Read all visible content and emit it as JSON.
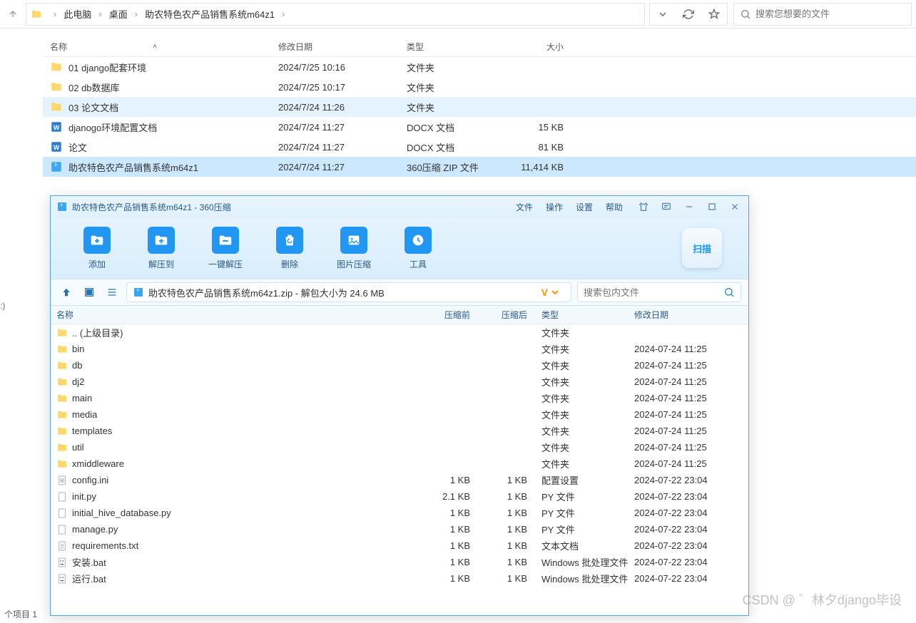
{
  "topbar": {
    "breadcrumb": [
      "此电脑",
      "桌面",
      "助农特色农产品销售系统m64z1"
    ],
    "search_placeholder": "搜索您想要的文件"
  },
  "filelist": {
    "headers": {
      "name": "名称",
      "date": "修改日期",
      "type": "类型",
      "size": "大小"
    },
    "rows": [
      {
        "icon": "folder",
        "name": "01 django配套环境",
        "date": "2024/7/25 10:16",
        "type": "文件夹",
        "size": ""
      },
      {
        "icon": "folder",
        "name": "02 db数据库",
        "date": "2024/7/25 10:17",
        "type": "文件夹",
        "size": ""
      },
      {
        "icon": "folder",
        "name": "03 论文文档",
        "date": "2024/7/24 11:26",
        "type": "文件夹",
        "size": "",
        "highlighted": true
      },
      {
        "icon": "word",
        "name": "djanogo环境配置文档",
        "date": "2024/7/24 11:27",
        "type": "DOCX 文档",
        "size": "15 KB"
      },
      {
        "icon": "word",
        "name": "论文",
        "date": "2024/7/24 11:27",
        "type": "DOCX 文档",
        "size": "81 KB"
      },
      {
        "icon": "zip",
        "name": "助农特色农产品销售系统m64z1",
        "date": "2024/7/24 11:27",
        "type": "360压缩 ZIP 文件",
        "size": "11,414 KB",
        "selected": true
      }
    ]
  },
  "zip": {
    "title": "助农特色农产品销售系统m64z1 - 360压缩",
    "menu": [
      "文件",
      "操作",
      "设置",
      "帮助"
    ],
    "toolbar": [
      {
        "label": "添加",
        "color": "#2196f3",
        "icon": "plus"
      },
      {
        "label": "解压到",
        "color": "#2196f3",
        "icon": "up"
      },
      {
        "label": "一键解压",
        "color": "#2196f3",
        "icon": "minus"
      },
      {
        "label": "删除",
        "color": "#2196f3",
        "icon": "recycle"
      },
      {
        "label": "图片压缩",
        "color": "#2196f3",
        "icon": "image"
      },
      {
        "label": "工具",
        "color": "#2196f3",
        "icon": "tool"
      }
    ],
    "scan_label": "扫描",
    "path": "助农特色农产品销售系统m64z1.zip - 解包大小为 24.6 MB",
    "search_placeholder": "搜索包内文件",
    "headers": {
      "name": "名称",
      "before": "压缩前",
      "after": "压缩后",
      "type": "类型",
      "date": "修改日期"
    },
    "rows": [
      {
        "icon": "folder",
        "name": ".. (上级目录)",
        "type": "文件夹"
      },
      {
        "icon": "folder",
        "name": "bin",
        "type": "文件夹",
        "date": "2024-07-24 11:25"
      },
      {
        "icon": "folder",
        "name": "db",
        "type": "文件夹",
        "date": "2024-07-24 11:25"
      },
      {
        "icon": "folder",
        "name": "dj2",
        "type": "文件夹",
        "date": "2024-07-24 11:25"
      },
      {
        "icon": "folder",
        "name": "main",
        "type": "文件夹",
        "date": "2024-07-24 11:25"
      },
      {
        "icon": "folder",
        "name": "media",
        "type": "文件夹",
        "date": "2024-07-24 11:25"
      },
      {
        "icon": "folder",
        "name": "templates",
        "type": "文件夹",
        "date": "2024-07-24 11:25"
      },
      {
        "icon": "folder",
        "name": "util",
        "type": "文件夹",
        "date": "2024-07-24 11:25"
      },
      {
        "icon": "folder",
        "name": "xmiddleware",
        "type": "文件夹",
        "date": "2024-07-24 11:25"
      },
      {
        "icon": "ini",
        "name": "config.ini",
        "before": "1 KB",
        "after": "1 KB",
        "type": "配置设置",
        "date": "2024-07-22 23:04"
      },
      {
        "icon": "file",
        "name": "init.py",
        "before": "2.1 KB",
        "after": "1 KB",
        "type": "PY 文件",
        "date": "2024-07-22 23:04"
      },
      {
        "icon": "file",
        "name": "initial_hive_database.py",
        "before": "1 KB",
        "after": "1 KB",
        "type": "PY 文件",
        "date": "2024-07-22 23:04"
      },
      {
        "icon": "file",
        "name": "manage.py",
        "before": "1 KB",
        "after": "1 KB",
        "type": "PY 文件",
        "date": "2024-07-22 23:04"
      },
      {
        "icon": "txt",
        "name": "requirements.txt",
        "before": "1 KB",
        "after": "1 KB",
        "type": "文本文档",
        "date": "2024-07-22 23:04"
      },
      {
        "icon": "bat",
        "name": "安装.bat",
        "before": "1 KB",
        "after": "1 KB",
        "type": "Windows 批处理文件",
        "date": "2024-07-22 23:04"
      },
      {
        "icon": "bat",
        "name": "运行.bat",
        "before": "1 KB",
        "after": "1 KB",
        "type": "Windows 批处理文件",
        "date": "2024-07-22 23:04"
      }
    ]
  },
  "statusbar": "个项目  1",
  "sidebar_fragment": ":)",
  "watermark": "CSDN @ ゛林夕django毕设"
}
